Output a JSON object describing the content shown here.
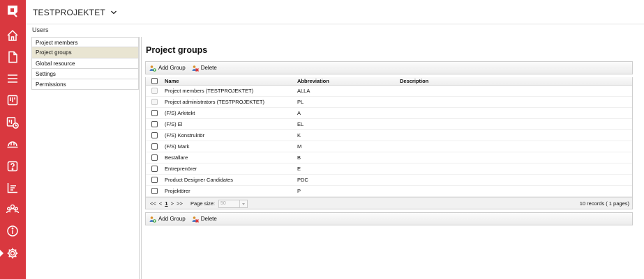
{
  "app": {
    "project_name": "TESTPROJEKTET",
    "breadcrumb": "Users"
  },
  "rail": {
    "icons": [
      "logo-icon",
      "home-icon",
      "document-icon",
      "menu-icon",
      "board-icon",
      "schedule-icon",
      "hardhat-icon",
      "help-icon",
      "chart-icon",
      "users-icon",
      "info-icon",
      "settings-icon"
    ],
    "active": "settings-icon"
  },
  "sidebar": {
    "items": [
      {
        "label": "Project members"
      },
      {
        "label": "Project groups"
      },
      {
        "label": "Global resource"
      },
      {
        "label": "Settings"
      },
      {
        "label": "Permissions"
      }
    ],
    "active_index": 1
  },
  "main": {
    "title": "Project groups",
    "toolbar": {
      "add_label": "Add Group",
      "delete_label": "Delete"
    },
    "columns": {
      "name": "Name",
      "abbreviation": "Abbreviation",
      "description": "Description"
    },
    "rows": [
      {
        "name": "Project members (TESTPROJEKTET)",
        "abbreviation": "ALLA",
        "description": "",
        "locked": true
      },
      {
        "name": "Project administrators (TESTPROJEKTET)",
        "abbreviation": "PL",
        "description": "",
        "locked": true
      },
      {
        "name": "(F/S) Arkitekt",
        "abbreviation": "A",
        "description": "",
        "locked": false
      },
      {
        "name": "(F/S) El",
        "abbreviation": "EL",
        "description": "",
        "locked": false
      },
      {
        "name": "(F/S) Konstruktör",
        "abbreviation": "K",
        "description": "",
        "locked": false
      },
      {
        "name": "(F/S) Mark",
        "abbreviation": "M",
        "description": "",
        "locked": false
      },
      {
        "name": "Beställare",
        "abbreviation": "B",
        "description": "",
        "locked": false
      },
      {
        "name": "Entreprenörer",
        "abbreviation": "E",
        "description": "",
        "locked": false
      },
      {
        "name": "Product Designer Candidates",
        "abbreviation": "PDC",
        "description": "",
        "locked": false
      },
      {
        "name": "Projektörer",
        "abbreviation": "P",
        "description": "",
        "locked": false
      }
    ],
    "pager": {
      "first": "<<",
      "prev": "<",
      "current": "1",
      "next": ">",
      "last": ">>",
      "page_size_label": "Page size:",
      "page_size": "50",
      "records": "10 records ( 1 pages)"
    }
  },
  "colors": {
    "rail": "#d9383f",
    "active_item": "#e9e5d2"
  }
}
